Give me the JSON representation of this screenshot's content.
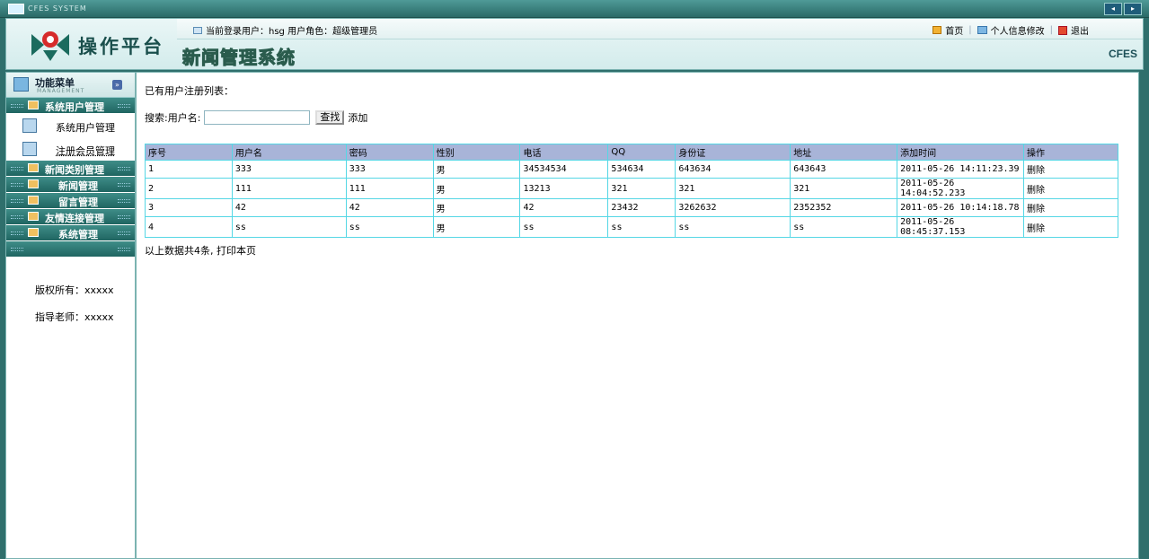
{
  "window": {
    "sys_title": "CFES SYSTEM",
    "buttons": [
      "◂",
      "▸"
    ]
  },
  "header": {
    "logo_text": "操作平台",
    "user_label": "当前登录用户：hsg  用户角色：超级管理员",
    "links": {
      "home": "首页",
      "profile": "个人信息修改",
      "logout": "退出"
    },
    "system_title": "新闻管理系统",
    "brand": "CFES"
  },
  "sidebar": {
    "menu_title": "功能菜单",
    "menu_sub": "MANAGEMENT",
    "groups": [
      {
        "label": "系统用户管理"
      },
      {
        "label": "新闻类别管理"
      },
      {
        "label": "新闻管理"
      },
      {
        "label": "留言管理"
      },
      {
        "label": "友情连接管理"
      },
      {
        "label": "系统管理"
      }
    ],
    "subitems": [
      {
        "label": "系统用户管理"
      },
      {
        "label": "注册会员管理"
      }
    ],
    "copyright": "版权所有：xxxxx",
    "teacher": "指导老师：xxxxx"
  },
  "main": {
    "list_title": "已有用户注册列表：",
    "search_label": "搜索:用户名:",
    "search_value": "",
    "search_button": "查找",
    "add_link": "添加",
    "columns": [
      "序号",
      "用户名",
      "密码",
      "性别",
      "电话",
      "QQ",
      "身份证",
      "地址",
      "添加时间",
      "操作"
    ],
    "rows": [
      [
        "1",
        "333",
        "333",
        "男",
        "34534534",
        "534634",
        "643634",
        "643643",
        "2011-05-26 14:11:23.39",
        "删除"
      ],
      [
        "2",
        "111",
        "111",
        "男",
        "13213",
        "321",
        "321",
        "321",
        "2011-05-26 14:04:52.233",
        "删除"
      ],
      [
        "3",
        "42",
        "42",
        "男",
        "42",
        "23432",
        "3262632",
        "2352352",
        "2011-05-26 10:14:18.78",
        "删除"
      ],
      [
        "4",
        "ss",
        "ss",
        "男",
        "ss",
        "ss",
        "ss",
        "ss",
        "2011-05-26 08:45:37.153",
        "删除"
      ]
    ],
    "footer": "以上数据共4条, 打印本页"
  }
}
